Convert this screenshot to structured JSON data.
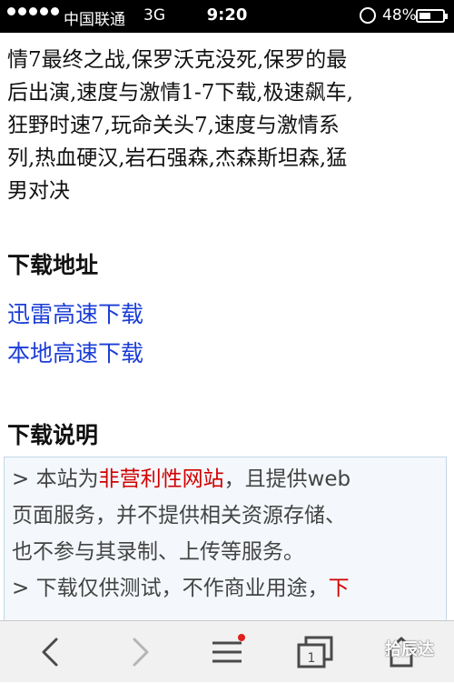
{
  "status_bar": {
    "carrier": "中国联通",
    "network": "3G",
    "time": "9:20",
    "battery": "48%",
    "battery_level": 0.48
  },
  "article": {
    "lines": [
      "情7最终之战,保罗沃克没死,保罗的最",
      "后出演,速度与激情1-7下载,极速飙车,",
      "狂野时速7,玩命关头7,速度与激情系",
      "列,热血硬汉,岩石强森,杰森斯坦森,猛",
      "男对决"
    ]
  },
  "download": {
    "heading": "下载地址",
    "links": [
      "迅雷高速下载",
      "本地高速下载"
    ]
  },
  "notes": {
    "heading": "下载说明",
    "line1_prefix": "> 本站为",
    "line1_highlight": "非营利性网站",
    "line1_suffix": "，且提供web",
    "line2": "页面服务，并不提供相关资源存储、",
    "line3": "也不参与其录制、上传等服务。",
    "line4_prefix": "> 下载仅供测试，不作商业用途，",
    "line4_highlight": "下"
  },
  "toolbar": {
    "tab_count": "1",
    "icons": [
      "back-icon",
      "forward-icon",
      "menu-icon",
      "tabs-icon",
      "home-icon"
    ],
    "accent": "#e0201b"
  },
  "watermark": "拾辰达"
}
